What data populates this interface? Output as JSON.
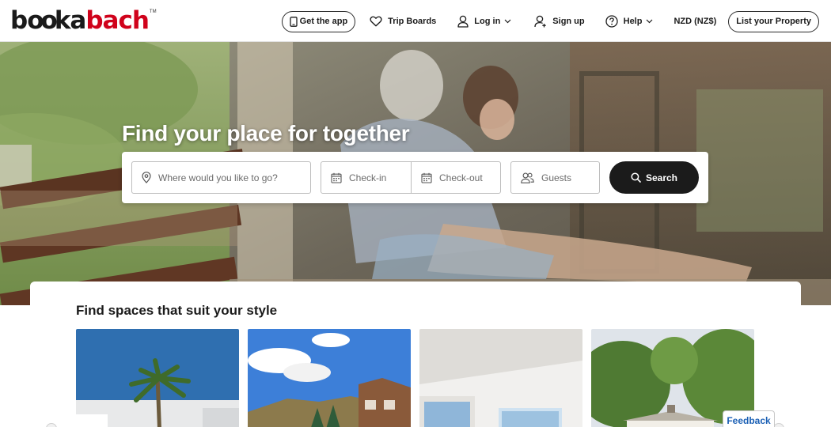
{
  "brand": {
    "logo_book": "bo",
    "logo_book2": "kabach",
    "logo_full": "bookabach",
    "logo_tm": "TM",
    "accent_color": "#d0021b"
  },
  "header": {
    "get_app": "Get the app",
    "trip_boards": "Trip Boards",
    "log_in": "Log in",
    "sign_up": "Sign up",
    "help": "Help",
    "currency": "NZD (NZ$)",
    "list_property": "List your Property"
  },
  "hero": {
    "title": "Find your place for together"
  },
  "search": {
    "where_placeholder": "Where would you like to go?",
    "checkin_placeholder": "Check-in",
    "checkout_placeholder": "Check-out",
    "guests_placeholder": "Guests",
    "button_label": "Search"
  },
  "styles_section": {
    "title": "Find spaces that suit your style"
  },
  "feedback": {
    "label": "Feedback"
  },
  "icons": {
    "phone": "phone-icon",
    "heart": "heart-icon",
    "user": "user-icon",
    "user_add": "user-add-icon",
    "help": "help-circle-icon",
    "location": "location-pin-icon",
    "calendar": "calendar-icon",
    "guests": "guests-icon",
    "search": "search-icon"
  }
}
